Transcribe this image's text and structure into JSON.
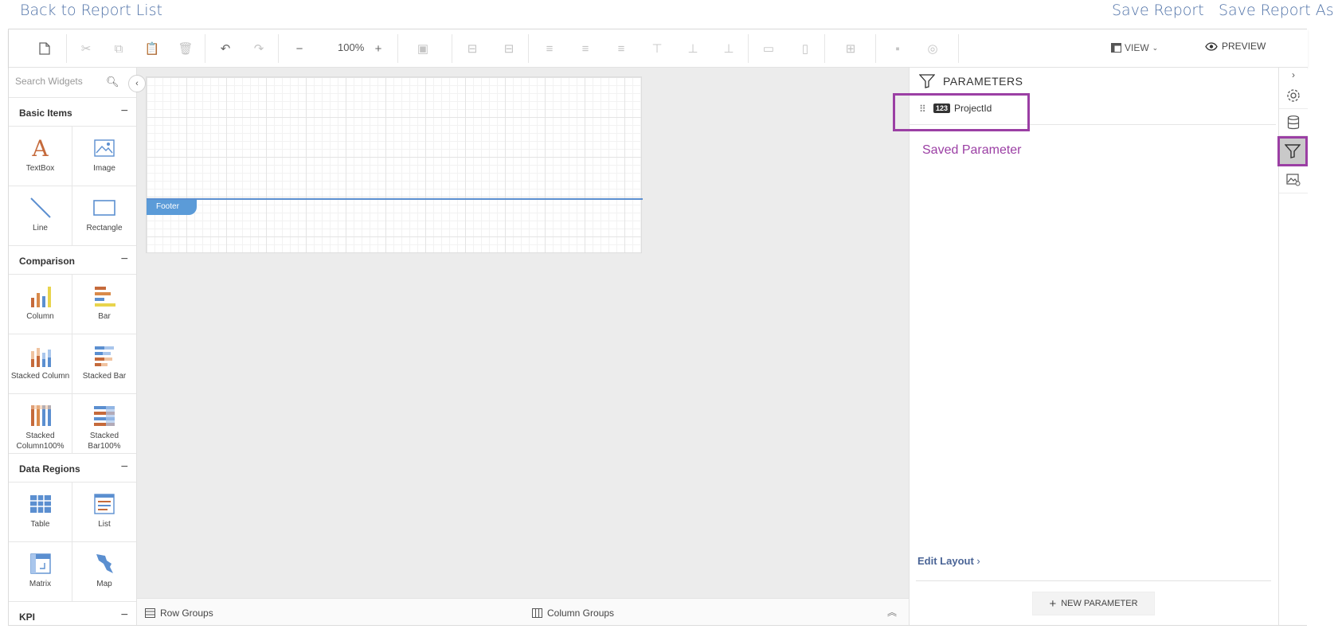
{
  "top_links": {
    "back": "Back to Report List",
    "save": "Save Report",
    "save_as": "Save Report As"
  },
  "toolbar": {
    "zoom": "100%",
    "view_label": "VIEW",
    "preview_label": "PREVIEW"
  },
  "widgets": {
    "search_placeholder": "Search Widgets",
    "categories": [
      {
        "name": "Basic Items",
        "items": [
          "TextBox",
          "Image",
          "Line",
          "Rectangle"
        ]
      },
      {
        "name": "Comparison",
        "items": [
          "Column",
          "Bar",
          "Stacked Column",
          "Stacked Bar",
          "Stacked Column100%",
          "Stacked Bar100%"
        ]
      },
      {
        "name": "Data Regions",
        "items": [
          "Table",
          "List",
          "Matrix",
          "Map"
        ]
      },
      {
        "name": "KPI",
        "items": []
      }
    ]
  },
  "canvas": {
    "footer_label": "Footer"
  },
  "groups": {
    "row": "Row Groups",
    "column": "Column Groups"
  },
  "parameters": {
    "title": "PARAMETERS",
    "items": [
      {
        "type_badge": "123",
        "name": "ProjectId"
      }
    ],
    "annotation": "Saved Parameter",
    "edit_layout": "Edit Layout",
    "new_button": "NEW PARAMETER"
  },
  "colors": {
    "accent": "#5173a8",
    "highlight": "#9b3fa4",
    "footer": "#5b9bd8"
  }
}
